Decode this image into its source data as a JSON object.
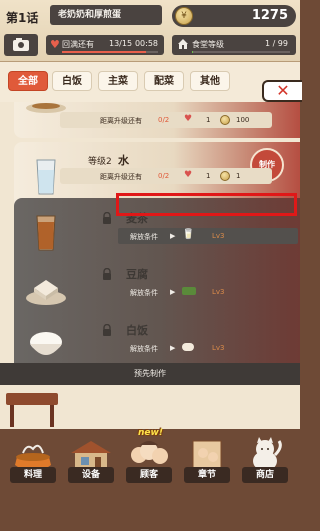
{
  "header": {
    "chapter": "第1话",
    "story_title": "老奶奶和厚煎蛋",
    "coin_icon": "coin-icon",
    "coins": "1275",
    "heart_label": "回满还有",
    "heart_count": "13/15",
    "heart_time": "00:58",
    "heart_progress": 0.87,
    "level_label": "食堂等级",
    "level_count": "1 / 99",
    "level_progress": 0.01
  },
  "tabs": [
    "全部",
    "白饭",
    "主菜",
    "配菜",
    "其他"
  ],
  "active_tab": "全部",
  "close_label": "✕",
  "recipes": [
    {
      "stat_label": "距离升级还有",
      "stat_progress": "0/2",
      "hearts": "1",
      "coin_value": "100"
    },
    {
      "level": "等级2",
      "name": "水",
      "make_label": "制作",
      "stat_label": "距离升级还有",
      "stat_progress": "0/2",
      "hearts": "1",
      "coin_value": "1"
    },
    {
      "name": "麦茶",
      "unlock_label": "解放条件",
      "unlock_level": "Lv3"
    },
    {
      "name": "豆腐",
      "unlock_label": "解放条件",
      "unlock_level": "Lv3"
    },
    {
      "name": "白饭",
      "unlock_label": "解放条件",
      "unlock_level": "Lv3"
    }
  ],
  "precreate_label": "预先制作",
  "nav": [
    {
      "label": "料理",
      "icon": "cooking-icon"
    },
    {
      "label": "设备",
      "icon": "equipment-icon"
    },
    {
      "label": "顾客",
      "icon": "customers-icon",
      "badge": "new!"
    },
    {
      "label": "章节",
      "icon": "chapter-icon"
    },
    {
      "label": "商店",
      "icon": "shop-icon"
    }
  ]
}
